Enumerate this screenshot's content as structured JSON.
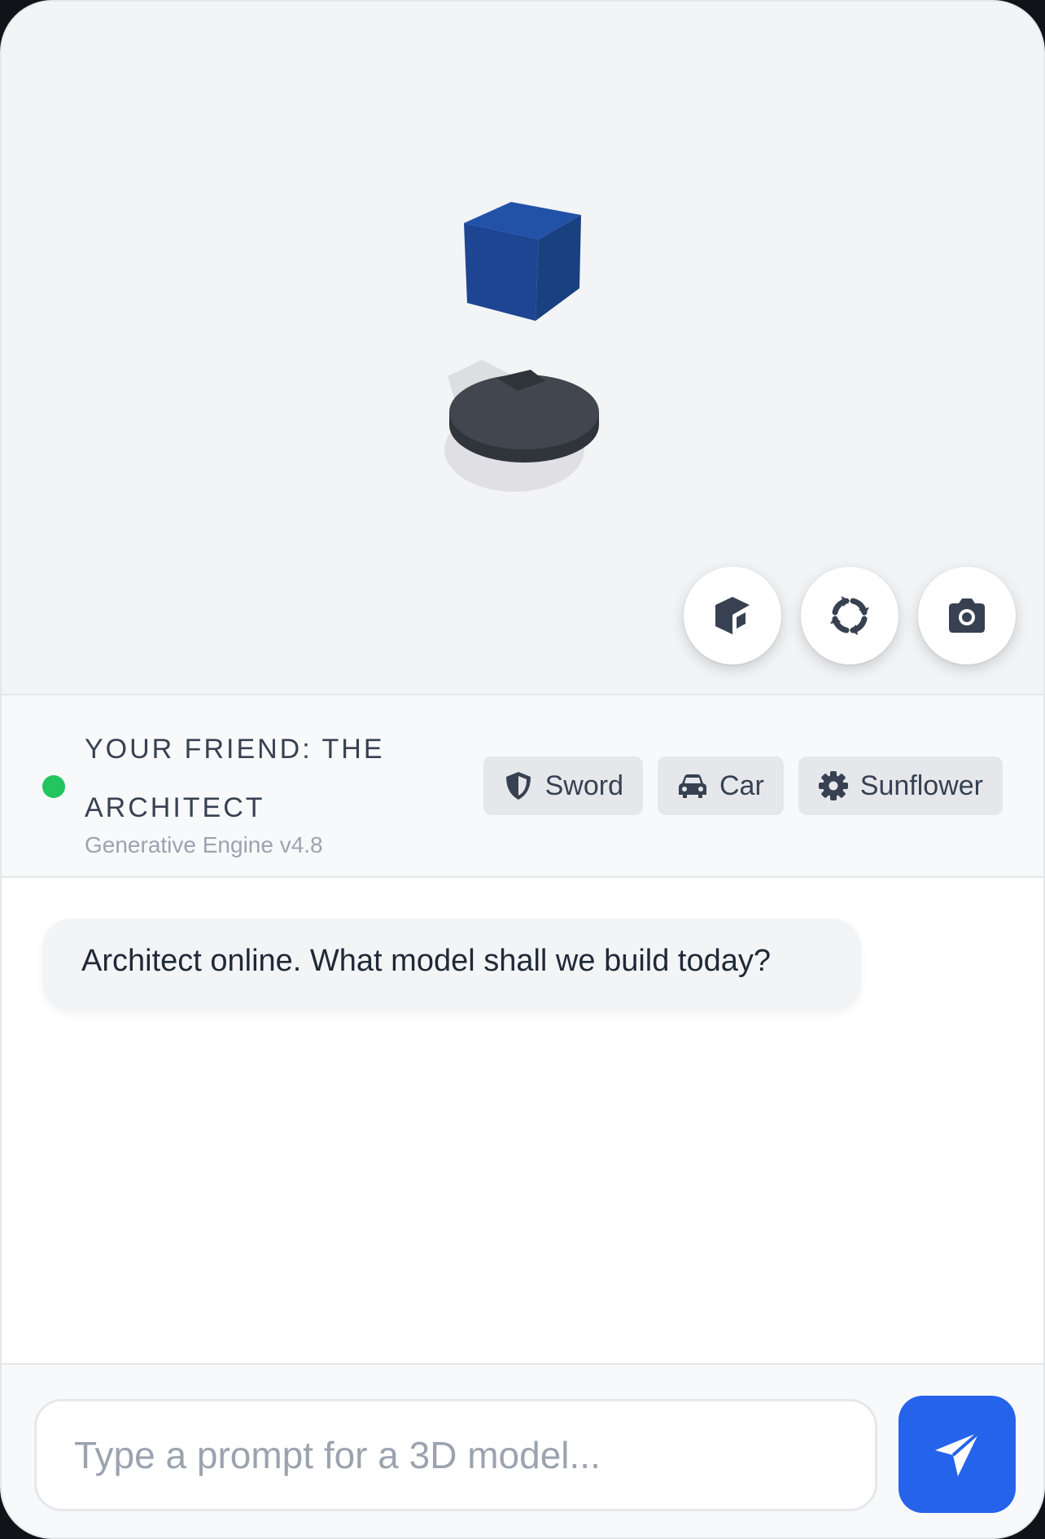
{
  "viewport": {
    "controls": [
      {
        "name": "model-view-button",
        "icon": "cube-icon"
      },
      {
        "name": "rotate-button",
        "icon": "rotate-arrows-icon"
      },
      {
        "name": "screenshot-button",
        "icon": "camera-icon"
      }
    ],
    "colors": {
      "cube": "#1e4a99",
      "platform": "#3f444d",
      "background": "#f3f4f6"
    }
  },
  "header": {
    "title": "YOUR FRIEND: THE ARCHITECT",
    "subtitle": "Generative Engine v4.8",
    "status_color": "#22c55e",
    "presets": [
      {
        "label": "Sword",
        "icon": "shield-icon"
      },
      {
        "label": "Car",
        "icon": "car-icon"
      },
      {
        "label": "Sunflower",
        "icon": "gear-icon"
      }
    ]
  },
  "chat": {
    "messages": [
      {
        "sender": "assistant",
        "text": "Architect online. What model shall we build today?"
      }
    ]
  },
  "composer": {
    "placeholder": "Type a prompt for a 3D model...",
    "value": "",
    "send_icon": "send-icon",
    "accent": "#2563eb"
  }
}
